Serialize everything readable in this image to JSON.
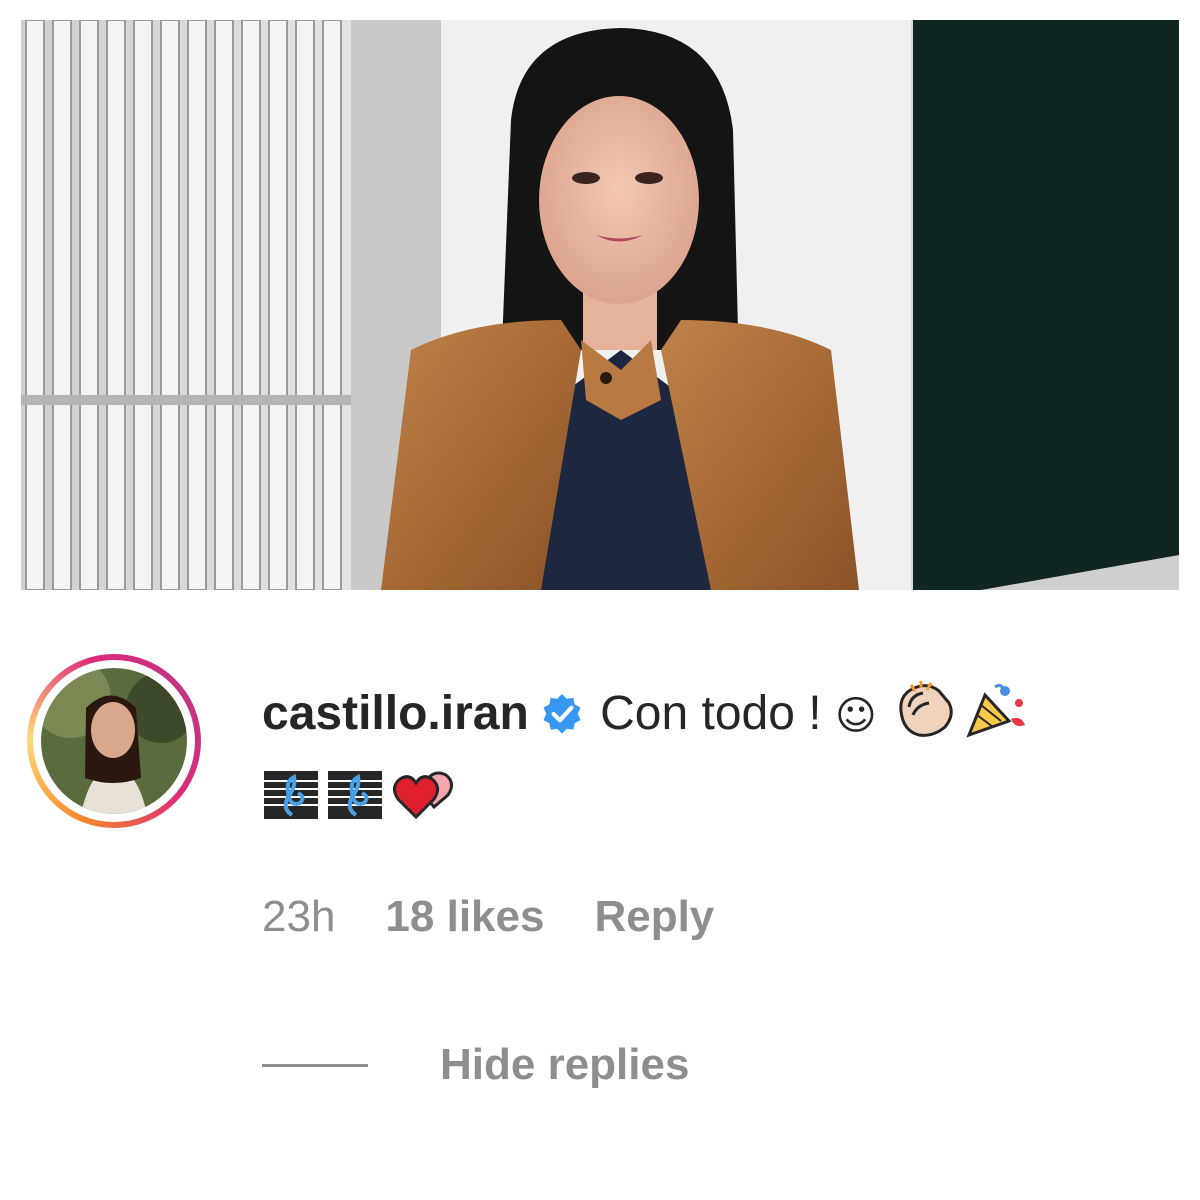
{
  "comment": {
    "username": "castillo.iran",
    "text": "Con todo !",
    "smiley": "☺",
    "time": "23h",
    "likes": "18 likes",
    "reply_label": "Reply",
    "hide_replies_label": "Hide replies"
  },
  "colors": {
    "verified": "#3897f0",
    "meta_text": "#8e8e8e",
    "text": "#262626"
  },
  "icons": [
    "verified-badge-icon",
    "clapping-hands-icon",
    "party-popper-icon",
    "musical-score-icon",
    "musical-score-icon",
    "two-hearts-icon"
  ]
}
